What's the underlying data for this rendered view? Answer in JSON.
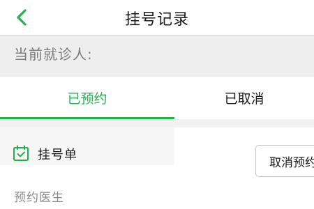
{
  "header": {
    "title": "挂号记录",
    "back_icon": "chevron-left-icon"
  },
  "patient": {
    "label": "当前就诊人:"
  },
  "tabs": [
    {
      "label": "已预约",
      "active": true
    },
    {
      "label": "已取消",
      "active": false
    }
  ],
  "card": {
    "icon": "calendar-check-icon",
    "title": "挂号单",
    "cancel_button_label": "取消预约",
    "doctor_label": "预约医生"
  },
  "colors": {
    "accent": "#22b14c",
    "text_primary": "#1a1a1a",
    "text_secondary": "#7a7a7a"
  }
}
